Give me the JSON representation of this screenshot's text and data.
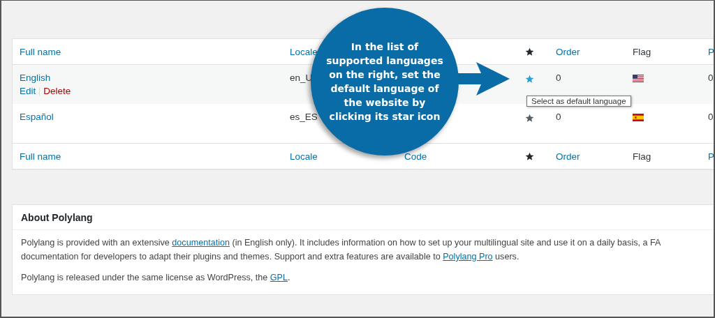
{
  "languages_table": {
    "header": [
      {
        "label": "Full name",
        "kind": "link"
      },
      {
        "label": "Locale",
        "kind": "link"
      },
      {
        "kind": "blank"
      },
      {
        "kind": "star"
      },
      {
        "label": "Order",
        "kind": "link"
      },
      {
        "label": "Flag",
        "kind": "text"
      },
      {
        "label": "P",
        "kind": "link"
      }
    ],
    "rows": [
      {
        "name": "English",
        "actions": [
          {
            "label": "Edit",
            "kind": "edit"
          },
          {
            "label": "Delete",
            "kind": "delete"
          }
        ],
        "locale": "en_U",
        "star_highlighted": true,
        "order": "0",
        "flag": {
          "kind": "us"
        },
        "column_7": "0"
      },
      {
        "name": "Español",
        "actions": [],
        "locale": "es_ES",
        "star_highlighted": false,
        "order": "0",
        "flag": {
          "kind": "es"
        },
        "column_7": "0"
      }
    ],
    "footer": [
      {
        "label": "Full name",
        "kind": "link"
      },
      {
        "label": "Locale",
        "kind": "link"
      },
      {
        "label": "Code",
        "kind": "link"
      },
      {
        "kind": "star"
      },
      {
        "label": "Order",
        "kind": "link"
      },
      {
        "label": "Flag",
        "kind": "text"
      },
      {
        "label": "P",
        "kind": "link"
      }
    ]
  },
  "tooltip": "Select as default language",
  "callout": {
    "text": "In the list of supported languages on the right, set the default language of the website by clicking its star icon"
  },
  "about": {
    "title": "About Polylang",
    "paragraphs": [
      {
        "lines": [
          [
            {
              "text": "Polylang is provided with an extensive "
            },
            {
              "text": "documentation",
              "link": true
            },
            {
              "text": " (in English only). It includes information on how to set up your multilingual site and use it on a daily basis, a FA"
            }
          ],
          [
            {
              "text": "documentation for developers to adapt their plugins and themes. Support and extra features are available to "
            },
            {
              "text": "Polylang Pro",
              "link": true
            },
            {
              "text": " users."
            }
          ]
        ]
      },
      {
        "lines": [
          [
            {
              "text": "Polylang is released under the same license as WordPress, the "
            },
            {
              "text": "GPL",
              "link": true
            },
            {
              "text": "."
            }
          ]
        ]
      }
    ]
  }
}
